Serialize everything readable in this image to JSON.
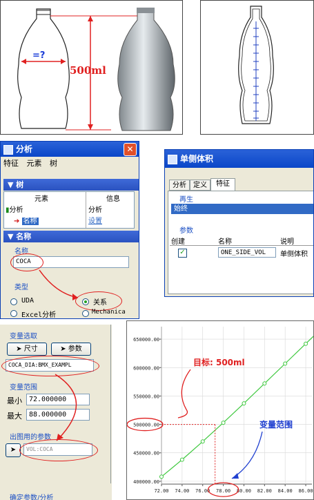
{
  "bottle_left": {
    "width_label": "=?",
    "volume_label": "500ml"
  },
  "analysis_window": {
    "title": "分析",
    "close_glyph": "✕",
    "menu": [
      "特征",
      "元素",
      "树"
    ],
    "tree_section": "树",
    "tree_headers": [
      "元素",
      "信息"
    ],
    "tree_rows": [
      {
        "element": "分析",
        "info": "分析"
      },
      {
        "element": "名称",
        "info": "设置"
      }
    ],
    "name_section": "名称",
    "name_label": "名称",
    "name_value": "COCA",
    "type_label": "类型",
    "types": [
      "UDA",
      "关系",
      "Excel分析",
      "Mechanica"
    ],
    "selected_type": "关系"
  },
  "one_side_window": {
    "title": "单侧体积",
    "tabs": [
      "分析",
      "定义",
      "特征"
    ],
    "regen_label": "再生",
    "regen_value": "始终",
    "params_label": "参数",
    "param_headers": [
      "创建",
      "名称",
      "说明"
    ],
    "param_row": {
      "name": "ONE_SIDE_VOL",
      "desc": "单侧体积"
    }
  },
  "variable_panel": {
    "selection_label": "变量选取",
    "btn_dimension": "尺寸",
    "btn_param": "参数",
    "dimension_value": "COCA_DIA:BMX_EXAMPL",
    "range_label": "变量范围",
    "min_label": "最小",
    "min_value": "72.000000",
    "max_label": "最大",
    "max_value": "88.000000",
    "plot_params_label": "出图用的参数",
    "plot_param_value": "VOL:COCA",
    "bottom_text": "确定参数/分析"
  },
  "chart_data": {
    "type": "line",
    "x": [
      72,
      74,
      76,
      78,
      80,
      82,
      84,
      86,
      88
    ],
    "y": [
      408000,
      438000,
      470000,
      503000,
      537000,
      572000,
      607000,
      642000,
      677000
    ],
    "x_ticks": [
      "72.00",
      "74.00",
      "76.00",
      "78.00",
      "80.00",
      "82.00",
      "84.00",
      "86.00"
    ],
    "y_ticks": [
      "400000.00",
      "450000.00",
      "500000.00",
      "550000.00",
      "600000.00",
      "650000.00"
    ],
    "xlim": [
      72,
      86.6
    ],
    "ylim": [
      395000,
      672000
    ],
    "grid": true,
    "line_color": "#3ec83e",
    "annotation_target": "目标: 500ml",
    "annotation_range": "变量范围",
    "target_x": 77.2,
    "target_y": 500000
  }
}
